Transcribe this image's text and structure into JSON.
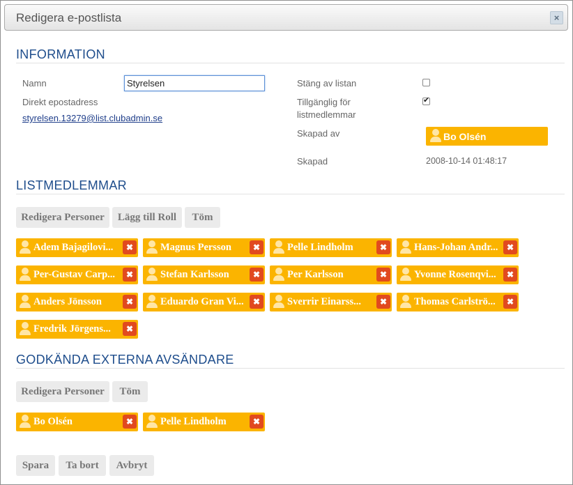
{
  "dialog": {
    "title": "Redigera e-postlista",
    "close_icon": "×"
  },
  "information": {
    "heading": "INFORMATION",
    "name_label": "Namn",
    "name_value": "Styrelsen",
    "direct_email_label": "Direkt epostadress",
    "direct_email": "styrelsen.13279@list.clubadmin.se",
    "close_list_label": "Stäng av listan",
    "close_list_checked": false,
    "available_label_line1": "Tillgänglig för",
    "available_label_line2": "listmedlemmar",
    "available_checked": true,
    "created_by_label": "Skapad av",
    "created_by": "Bo Olsén",
    "created_label": "Skapad",
    "created": "2008-10-14 01:48:17"
  },
  "list_members": {
    "heading": "LISTMEDLEMMAR",
    "buttons": [
      "Redigera Personer",
      "Lägg till Roll",
      "Töm"
    ],
    "members": [
      "Adem Bajagilovi...",
      "Magnus Persson",
      "Pelle Lindholm",
      "Hans-Johan Andr...",
      "Per-Gustav Carp...",
      "Stefan Karlsson",
      "Per Karlsson",
      "Yvonne Rosenqvi...",
      "Anders Jönsson",
      "Eduardo Gran Vi...",
      "Sverrir Einarss...",
      "Thomas Carlströ...",
      "Fredrik Jörgens..."
    ]
  },
  "external_senders": {
    "heading": "GODKÄNDA EXTERNA AVSÄNDARE",
    "buttons": [
      "Redigera Personer",
      "Töm"
    ],
    "senders": [
      "Bo Olsén",
      "Pelle Lindholm"
    ]
  },
  "footer": {
    "buttons": [
      "Spara",
      "Ta bort",
      "Avbryt"
    ]
  },
  "icons": {
    "person": "person-icon",
    "remove": "remove-icon",
    "close": "close-icon"
  },
  "colors": {
    "tag": "#fbb400",
    "remove": "#e14a1f",
    "heading": "#1e4d8c"
  }
}
